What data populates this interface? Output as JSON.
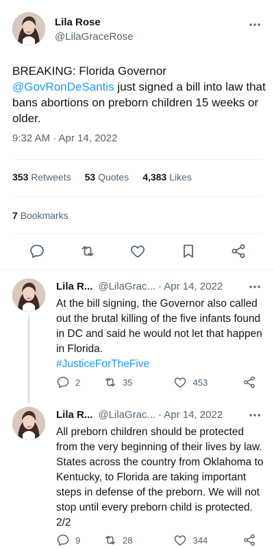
{
  "main_tweet": {
    "author_name": "Lila Rose",
    "author_handle": "@LilaGraceRose",
    "text_prefix": "BREAKING: Florida Governor ",
    "mention": "@GovRonDeSantis",
    "text_suffix": " just signed a bill into law that bans abortions on preborn children 15 weeks or older.",
    "timestamp": "9:32 AM · Apr 14, 2022",
    "retweets_count": "353",
    "retweets_label": "Retweets",
    "quotes_count": "53",
    "quotes_label": "Quotes",
    "likes_count": "4,383",
    "likes_label": "Likes",
    "bookmarks_count": "7",
    "bookmarks_label": "Bookmarks"
  },
  "replies": [
    {
      "name": "Lila R...",
      "handle": "@LilaGrac...",
      "date": "· Apr 14, 2022",
      "text": "At the bill signing, the Governor also called out the brutal killing of the five infants found in DC and said he would not let that happen in Florida.",
      "hashtag": "#JusticeForTheFive",
      "reply_count": "2",
      "retweet_count": "35",
      "like_count": "453"
    },
    {
      "name": "Lila R...",
      "handle": "@LilaGrac...",
      "date": "· Apr 14, 2022",
      "text": "All preborn children should be protected from the very beginning of their lives by law. States across the country from Oklahoma to Kentucky, to Florida are taking important steps in defense of the preborn. We will not stop until every preborn child is protected. 2/2",
      "reply_count": "9",
      "retweet_count": "28",
      "like_count": "344"
    }
  ],
  "colors": {
    "link": "#1d9bf0",
    "secondary_text": "#536471",
    "divider": "#eff3f4"
  },
  "icons": [
    "more-icon",
    "reply-icon",
    "retweet-icon",
    "like-icon",
    "bookmark-icon",
    "share-icon"
  ]
}
